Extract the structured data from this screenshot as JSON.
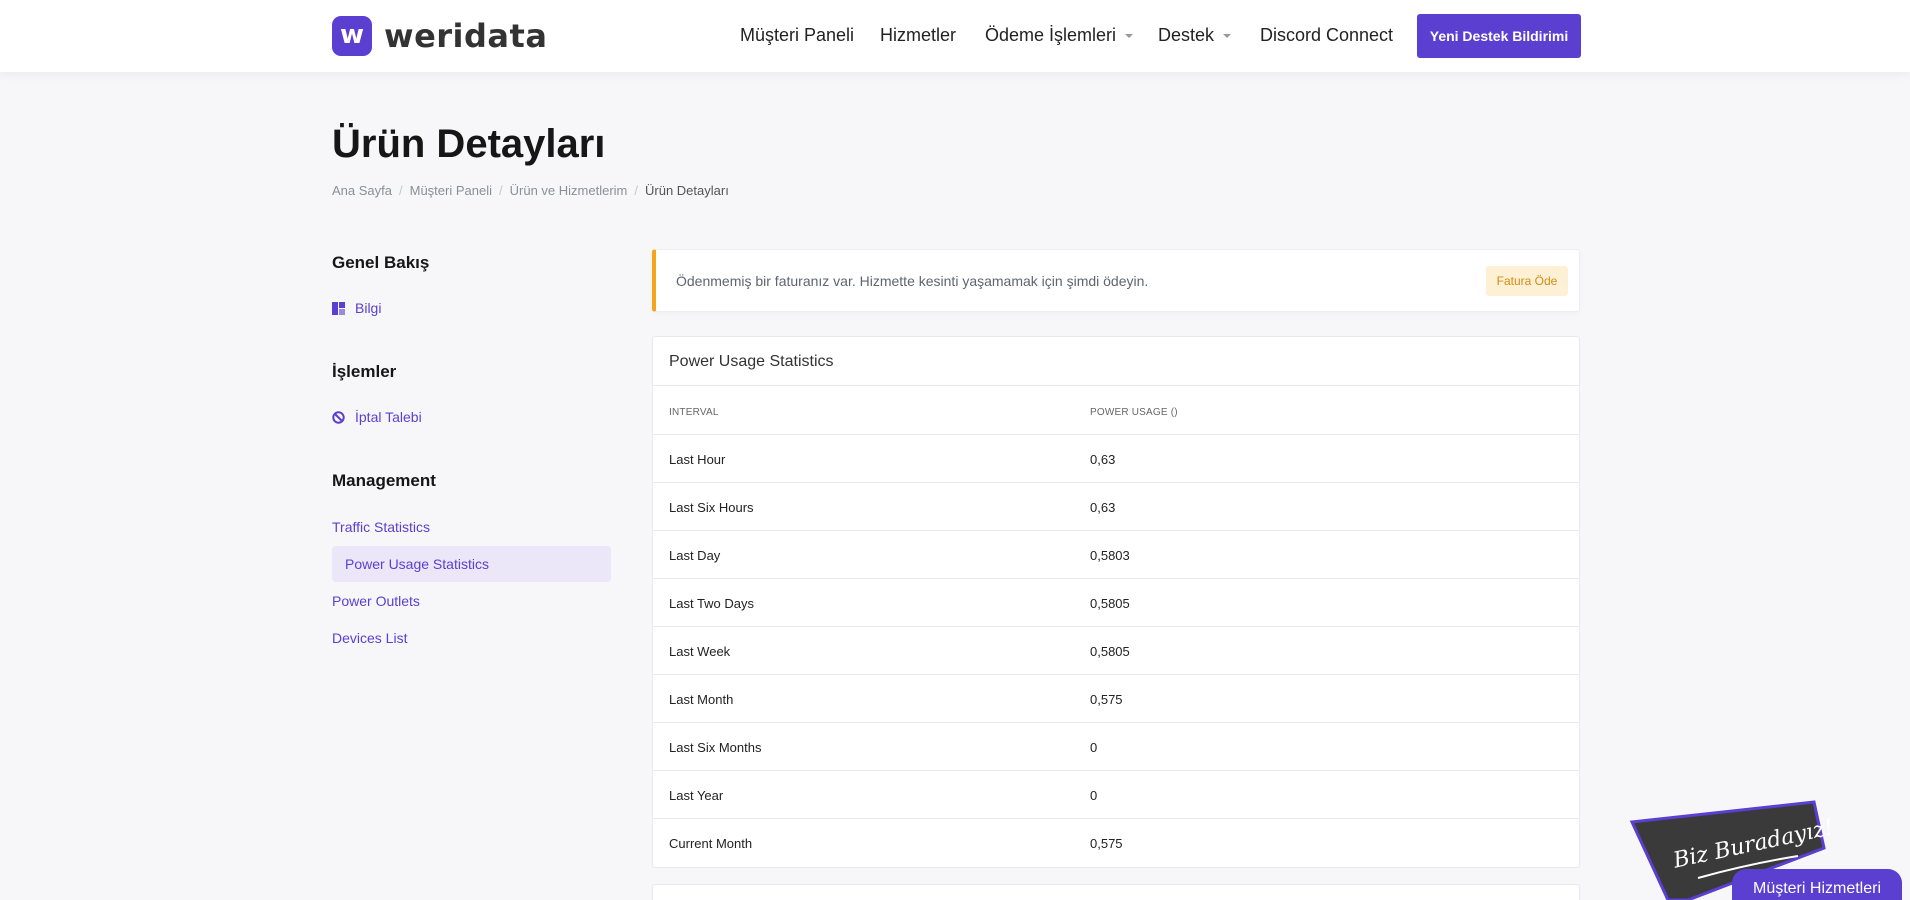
{
  "brand": {
    "name": "weridata",
    "mark": "w"
  },
  "nav": {
    "items": [
      {
        "label": "Müşteri Paneli",
        "dropdown": false
      },
      {
        "label": "Hizmetler",
        "dropdown": false
      },
      {
        "label": "Ödeme İşlemleri",
        "dropdown": true
      },
      {
        "label": "Destek",
        "dropdown": true
      },
      {
        "label": "Discord Connect",
        "dropdown": false
      }
    ],
    "cta_label": "Yeni Destek Bildirimi"
  },
  "page": {
    "title": "Ürün Detayları",
    "breadcrumb": [
      "Ana Sayfa",
      "Müşteri Paneli",
      "Ürün ve Hizmetlerim",
      "Ürün Detayları"
    ]
  },
  "sidebar": {
    "overview_heading": "Genel Bakış",
    "overview_item": "Bilgi",
    "actions_heading": "İşlemler",
    "actions_item": "İptal Talebi",
    "management_heading": "Management",
    "management_items": [
      "Traffic Statistics",
      "Power Usage Statistics",
      "Power Outlets",
      "Devices List"
    ],
    "active_item": "Power Usage Statistics"
  },
  "alert": {
    "text": "Ödenmemiş bir faturanız var. Hizmette kesinti yaşamamak için şimdi ödeyin.",
    "button_label": "Fatura Öde"
  },
  "power_table": {
    "title": "Power Usage Statistics",
    "columns": [
      "INTERVAL",
      "POWER USAGE ()"
    ],
    "rows": [
      [
        "Last Hour",
        "0,63"
      ],
      [
        "Last Six Hours",
        "0,63"
      ],
      [
        "Last Day",
        "0,5803"
      ],
      [
        "Last Two Days",
        "0,5805"
      ],
      [
        "Last Week",
        "0,5805"
      ],
      [
        "Last Month",
        "0,575"
      ],
      [
        "Last Six Months",
        "0"
      ],
      [
        "Last Year",
        "0"
      ],
      [
        "Current Month",
        "0,575"
      ]
    ]
  },
  "chat": {
    "board_text": "Biz Buradayız!",
    "tab_label": "Müşteri Hizmetleri"
  },
  "colors": {
    "accent": "#5b3fd1",
    "alert_border": "#f4a51c",
    "alert_button_bg": "#fdf0d5",
    "chat_board": "#3a3a3a"
  }
}
